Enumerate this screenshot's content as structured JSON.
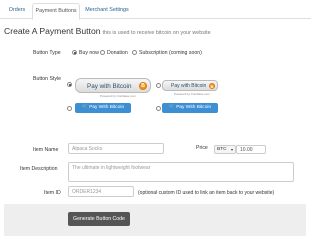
{
  "tabs": [
    {
      "label": "Orders"
    },
    {
      "label": "Payment Buttons"
    },
    {
      "label": "Merchant Settings"
    }
  ],
  "header": {
    "title": "Create A Payment Button",
    "subtitle": "this is used to receive bitcoin on your website"
  },
  "button_type": {
    "label": "Button Type",
    "options": [
      {
        "label": "Buy now",
        "selected": true
      },
      {
        "label": "Donation",
        "selected": false
      },
      {
        "label": "Subscription (coming soon)",
        "selected": false
      }
    ]
  },
  "button_style": {
    "label": "Button Style",
    "large_text": "Pay with Bitcoin",
    "small_text": "Pay with Bitcoin",
    "powered_text": "Powered by Coinbase.com",
    "blue_text": "Pay With Bitcoin",
    "coin_symbol": "B"
  },
  "item_name": {
    "label": "Item Name",
    "value": "Alpaca Socks"
  },
  "price": {
    "label": "Price",
    "currency": "BTC",
    "value": "10.00"
  },
  "item_description": {
    "label": "Item Description",
    "placeholder": "The ultimate in lightweight footwear"
  },
  "item_id": {
    "label": "Item ID",
    "placeholder": "ORDER1234",
    "help": "(optional custom ID used to link an item back to your website)"
  },
  "submit": {
    "label": "Generate Button Code"
  },
  "colors": {
    "accent": "#3d8fd4",
    "bitcoin": "#f7931a",
    "submit": "#555555"
  }
}
